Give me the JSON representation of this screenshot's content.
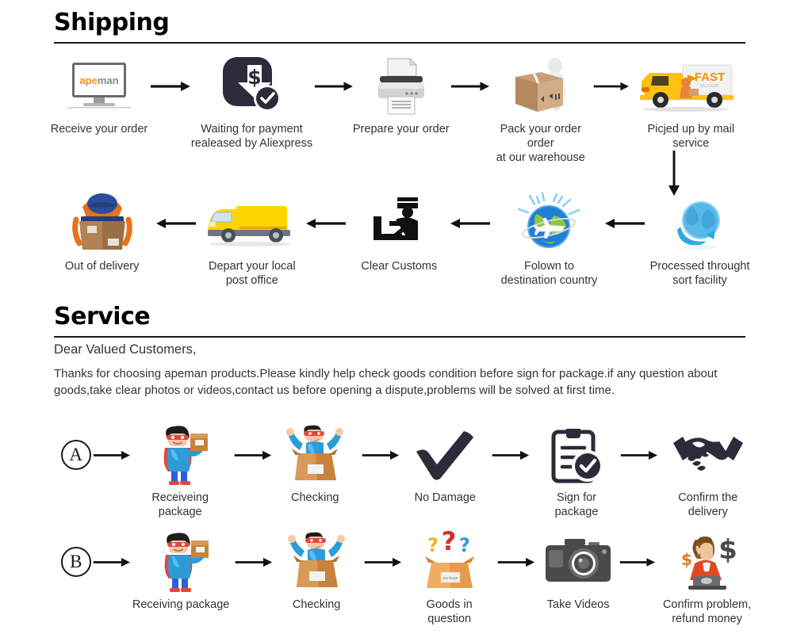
{
  "sections": {
    "shipping": {
      "title": "Shipping"
    },
    "service": {
      "title": "Service"
    }
  },
  "service_text": {
    "greeting": "Dear Valued Customers,",
    "body": "Thanks for choosing apeman products.Please kindly help check goods condition before sign for package.if any question about goods,take clear photos or videos,contact us before opening a dispute,problems will be solved at first time."
  },
  "brand": {
    "logo_ape": "ape",
    "logo_man": "man"
  },
  "shipping_row1": [
    {
      "icon": "monitor-order-icon",
      "label": "Receive your order"
    },
    {
      "icon": "payment-released-icon",
      "label": "Waiting for payment\nrealeased by Aliexpress"
    },
    {
      "icon": "printer-icon",
      "label": "Prepare your order"
    },
    {
      "icon": "packing-box-worker-icon",
      "label": "Pack your order order\nat our warehouse"
    },
    {
      "icon": "fast-delivery-truck-icon",
      "label": "Picjed up by mail service"
    }
  ],
  "shipping_row2": [
    {
      "icon": "courier-delivery-icon",
      "label": "Out of delivery"
    },
    {
      "icon": "yellow-van-icon",
      "label": "Depart your local\npost office"
    },
    {
      "icon": "customs-officer-icon",
      "label": "Clear Customs"
    },
    {
      "icon": "globe-airplane-icon",
      "label": "Folown to\ndestination country"
    },
    {
      "icon": "globe-sort-facility-icon",
      "label": "Processed throught\nsort facility"
    }
  ],
  "service_row_a": {
    "marker": "A",
    "steps": [
      {
        "icon": "superhero-package-icon",
        "label": "Receiveing package"
      },
      {
        "icon": "opening-box-icon",
        "label": "Checking"
      },
      {
        "icon": "checkmark-icon",
        "label": "No Damage"
      },
      {
        "icon": "clipboard-check-icon",
        "label": "Sign for package"
      },
      {
        "icon": "handshake-icon",
        "label": "Confirm the delivery"
      }
    ]
  },
  "service_row_b": {
    "marker": "B",
    "steps": [
      {
        "icon": "superhero-package-icon",
        "label": "Receiving package"
      },
      {
        "icon": "opening-box-icon",
        "label": "Checking"
      },
      {
        "icon": "question-box-icon",
        "label": "Goods in question"
      },
      {
        "icon": "camera-icon",
        "label": "Take Videos"
      },
      {
        "icon": "support-refund-icon",
        "label": "Confirm problem,\nrefund money"
      }
    ]
  },
  "colors": {
    "dark_navy": "#2B2B3A",
    "brand_orange": "#F29400",
    "truck_yellow": "#FFC20E",
    "box_tan": "#C8A077",
    "rule": "#1a1a1a",
    "text": "#333333"
  }
}
